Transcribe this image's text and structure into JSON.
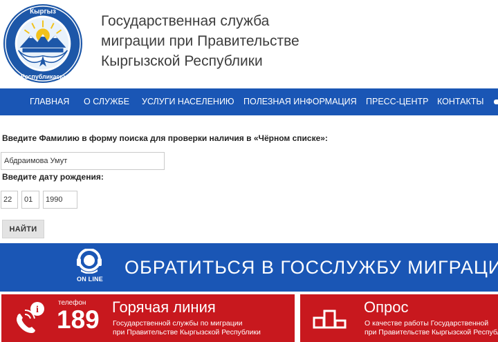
{
  "header": {
    "title_line1": "Государственная служба",
    "title_line2": "миграции при Правительстве",
    "title_line3": "Кыргызской Республики",
    "emblem_top_text": "Кыргыз",
    "emblem_bottom_text": "Республикасы"
  },
  "nav": {
    "items": [
      {
        "label": "ГЛАВНАЯ"
      },
      {
        "label": "О СЛУЖБЕ"
      },
      {
        "label": "УСЛУГИ НАСЕЛЕНИЮ"
      },
      {
        "label": "ПОЛЕЗНАЯ ИНФОРМАЦИЯ"
      },
      {
        "label": "ПРЕСС-ЦЕНТР"
      },
      {
        "label": "КОНТАКТЫ"
      }
    ]
  },
  "search_form": {
    "surname_label": "Введите Фамилию в форму поиска для проверки наличия в «Чёрном списке»:",
    "surname_value": "Абдраимова Умут",
    "birthdate_label": "Введите дату рождения:",
    "day_value": "22",
    "month_value": "01",
    "year_value": "1990",
    "submit_label": "НАЙТИ"
  },
  "online_banner": {
    "icon_label": "ON LINE",
    "text": "ОБРАТИТЬСЯ В ГОССЛУЖБУ МИГРАЦИИ"
  },
  "hotline": {
    "phone_word": "телефон",
    "phone_number": "189",
    "title": "Горячая линия",
    "subtitle_line1": "Государственной службы по миграции",
    "subtitle_line2": "при Правительстве Кыргызской Республики"
  },
  "poll": {
    "title": "Опрос",
    "subtitle_line1": "О качестве работы Государственной",
    "subtitle_line2": "при Правительстве Кыргызской Республики"
  },
  "colors": {
    "brand_blue": "#1a56b5",
    "hotline_red": "#c8181e",
    "emblem_blue": "#1d57a8",
    "emblem_gold": "#f2c21b"
  },
  "icons": [
    "state-emblem-icon",
    "online-support-icon",
    "phone-icon",
    "podium-icon"
  ]
}
